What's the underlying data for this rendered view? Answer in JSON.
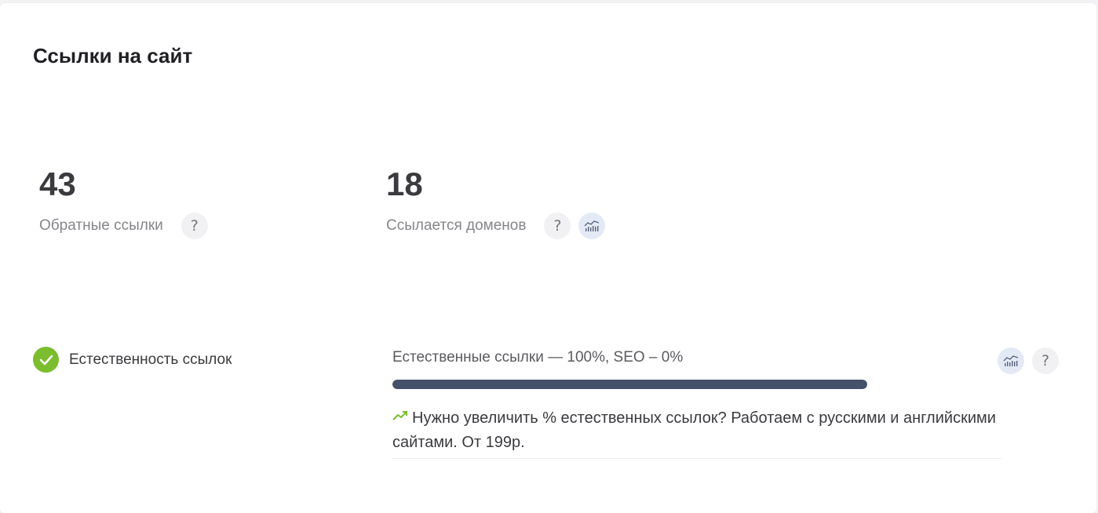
{
  "section": {
    "title": "Ссылки на сайт"
  },
  "metrics": [
    {
      "value": "43",
      "label": "Обратные ссылки"
    },
    {
      "value": "18",
      "label": "Ссылается доменов"
    }
  ],
  "naturalness": {
    "label": "Естественность ссылок",
    "status": "ok",
    "stats_text": "Естественные ссылки — 100%, SEO – 0%",
    "natural_percent": 100,
    "promo_text": "Нужно увеличить % естественных ссылок? Работаем с русскими и английскими сайтами. От 199р."
  },
  "icons": {
    "help": "question-mark-icon",
    "chart": "bar-chart-trend-icon",
    "check": "check-circle-icon",
    "trend": "trending-up-icon"
  },
  "colors": {
    "accent_green": "#7bbd2f",
    "progress_fill": "#45506a",
    "chart_icon_bg": "#e4eaf5"
  }
}
